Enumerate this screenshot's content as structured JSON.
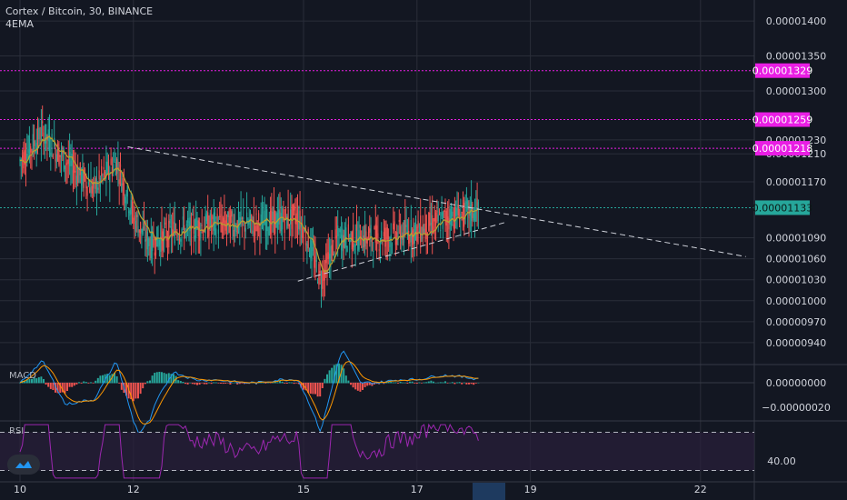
{
  "header": {
    "symbol_line": "Cortex / Bitcoin, 30, BINANCE",
    "indicator": "4EMA"
  },
  "panes": {
    "macd_label": "MACD",
    "rsi_label": "RSI"
  },
  "colors": {
    "background": "#131722",
    "grid": "#2a2e39",
    "up": "#26a69a",
    "down": "#ef5350",
    "ema": "#b8a230",
    "ema2": "#c0392b",
    "magenta": "#e91ee4",
    "teal": "#26a69a",
    "rsi": "#9c27b0",
    "macd_line": "#2196f3",
    "signal_line": "#ff9800"
  },
  "chart_data": [
    {
      "type": "candlestick",
      "title": "Cortex / Bitcoin, 30, BINANCE",
      "x_tick_labels": [
        "10",
        "12",
        "15",
        "17",
        "19",
        "22"
      ],
      "y_tick_labels": [
        "0.00001400",
        "0.00001350",
        "0.00001300",
        "0.00001230",
        "0.00001210",
        "0.00001170",
        "0.00001090",
        "0.00001060",
        "0.00001030",
        "0.00001000",
        "0.00000970",
        "0.00000940"
      ],
      "ylim": [
        9.1e-06,
        1.43e-05
      ],
      "horizontal_levels": [
        {
          "value": 1.329e-05,
          "label": "0.00001329",
          "style": "magenta-dotted"
        },
        {
          "value": 1.259e-05,
          "label": "0.00001259",
          "style": "magenta-dotted"
        },
        {
          "value": 1.218e-05,
          "label": "0.00001218",
          "style": "magenta-dotted"
        },
        {
          "value": 1.133e-05,
          "label": "0.00001133",
          "style": "teal-dotted"
        }
      ],
      "trendlines": [
        {
          "from": [
            "11.9",
            1.22e-05
          ],
          "to": [
            "22.8",
            1.063e-05
          ]
        },
        {
          "from": [
            "14.9",
            1.028e-05
          ],
          "to": [
            "18.6",
            1.113e-05
          ]
        }
      ],
      "series": [
        {
          "name": "4EMA",
          "values": "ema overlay"
        }
      ]
    },
    {
      "type": "line",
      "title": "MACD",
      "y_tick_labels": [
        "0.00000000",
        "−0.00000020"
      ]
    },
    {
      "type": "line",
      "title": "RSI",
      "y_tick_labels": [
        "40.00"
      ],
      "ylim": [
        20,
        80
      ]
    }
  ]
}
